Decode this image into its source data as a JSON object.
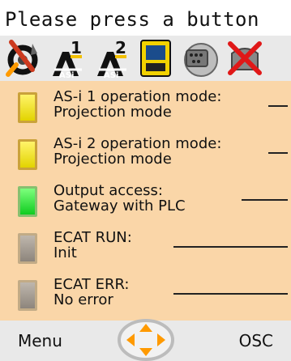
{
  "header": {
    "title": "Please press a button"
  },
  "toolbar": {
    "icons": [
      "settings-tools-icon",
      "asi-1-icon",
      "asi-2-icon",
      "device-icon",
      "interface-icon",
      "disabled-icon"
    ],
    "asi1_label": "ASi",
    "asi1_num": "1",
    "asi2_label": "ASi",
    "asi2_num": "2"
  },
  "status_rows": [
    {
      "line1": "AS-i 1 operation mode:",
      "line2": "Projection mode",
      "led": "yellow"
    },
    {
      "line1": "AS-i 2 operation mode:",
      "line2": "Projection mode",
      "led": "yellow"
    },
    {
      "line1": "Output access:",
      "line2": "Gateway with PLC",
      "led": "green"
    },
    {
      "line1": "ECAT RUN:",
      "line2": "Init",
      "led": "gray"
    },
    {
      "line1": "ECAT ERR:",
      "line2": "No error",
      "led": "gray"
    }
  ],
  "bottom_bar": {
    "left_label": "Menu",
    "right_label": "OSC"
  },
  "colors": {
    "panel_bg": "#fad6a8",
    "bar_bg": "#e9e9e9",
    "led_yellow": "#f2e41a",
    "led_green": "#22dd33",
    "led_gray": "#a39a90",
    "nav_orange": "#ff9a00"
  }
}
